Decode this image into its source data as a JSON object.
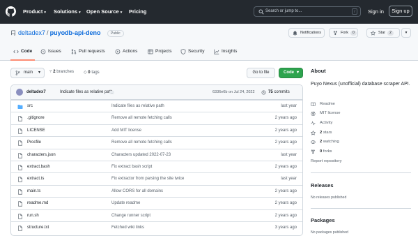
{
  "header": {
    "nav": [
      {
        "label": "Product",
        "has_caret": true
      },
      {
        "label": "Solutions",
        "has_caret": true
      },
      {
        "label": "Open Source",
        "has_caret": true
      },
      {
        "label": "Pricing",
        "has_caret": false
      }
    ],
    "search_placeholder": "Search or jump to...",
    "search_shortcut": "/",
    "sign_in": "Sign in",
    "sign_up": "Sign up"
  },
  "repo": {
    "owner": "deltadex7",
    "separator": "/",
    "name": "puyodb-api-deno",
    "visibility": "Public",
    "notifications_label": "Notifications",
    "fork_label": "Fork",
    "fork_count": "0",
    "star_label": "Star",
    "star_count": "2"
  },
  "tabs": [
    {
      "label": "Code",
      "icon": "code-icon",
      "active": true
    },
    {
      "label": "Issues",
      "icon": "issue-icon",
      "active": false
    },
    {
      "label": "Pull requests",
      "icon": "pull-request-icon",
      "active": false
    },
    {
      "label": "Actions",
      "icon": "play-icon",
      "active": false
    },
    {
      "label": "Projects",
      "icon": "table-icon",
      "active": false
    },
    {
      "label": "Security",
      "icon": "shield-icon",
      "active": false
    },
    {
      "label": "Insights",
      "icon": "graph-icon",
      "active": false
    }
  ],
  "branch_bar": {
    "branch": "main",
    "branches_count": "2",
    "branches_label": "branches",
    "tags_count": "0",
    "tags_label": "tags",
    "go_to_file": "Go to file",
    "code_button": "Code"
  },
  "latest_commit": {
    "author": "deltadex7",
    "message": "Indicate files as relative path",
    "ellipsis": "...",
    "sha_and_date": "6336e6b  on Jul 24, 2022",
    "commit_count": "75",
    "commits_label": "commits"
  },
  "files": [
    {
      "name": "src",
      "type": "dir",
      "message": "Indicate files as relative path",
      "age": "last year"
    },
    {
      "name": ".gitignore",
      "type": "file",
      "message": "Remove all remote fetching calls",
      "age": "2 years ago"
    },
    {
      "name": "LICENSE",
      "type": "file",
      "message": "Add MIT license",
      "age": "2 years ago"
    },
    {
      "name": "Procfile",
      "type": "file",
      "message": "Remove all remote fetching calls",
      "age": "2 years ago"
    },
    {
      "name": "characters.json",
      "type": "file",
      "message": "Characters updated 2022-07-23",
      "age": "last year"
    },
    {
      "name": "extract.bash",
      "type": "file",
      "message": "Fix extract bash script",
      "age": "2 years ago"
    },
    {
      "name": "extract.ts",
      "type": "file",
      "message": "Fix extractor from parsing the site twice",
      "age": "last year"
    },
    {
      "name": "main.ts",
      "type": "file",
      "message": "Allow CORS for all domains",
      "age": "2 years ago"
    },
    {
      "name": "readme.md",
      "type": "file",
      "message": "Update readme",
      "age": "2 years ago"
    },
    {
      "name": "run.sh",
      "type": "file",
      "message": "Change runner script",
      "age": "2 years ago"
    },
    {
      "name": "structure.txt",
      "type": "file",
      "message": "Fetched wiki links",
      "age": "3 years ago"
    }
  ],
  "sidebar": {
    "about_title": "About",
    "description": "Puyo Nexus (unofficial) database scraper API.",
    "readme": "Readme",
    "license": "MIT license",
    "activity": "Activity",
    "stars_count": "2",
    "stars_label": "stars",
    "watching_count": "2",
    "watching_label": "watching",
    "forks_count": "0",
    "forks_label": "forks",
    "report": "Report repository",
    "releases_title": "Releases",
    "releases_empty": "No releases published",
    "packages_title": "Packages",
    "packages_empty": "No packages published"
  },
  "colors": {
    "header_bg": "#24292f",
    "link": "#0969da",
    "green_button": "#2da44e",
    "active_tab_underline": "#fd8c73",
    "folder": "#54aeff"
  }
}
